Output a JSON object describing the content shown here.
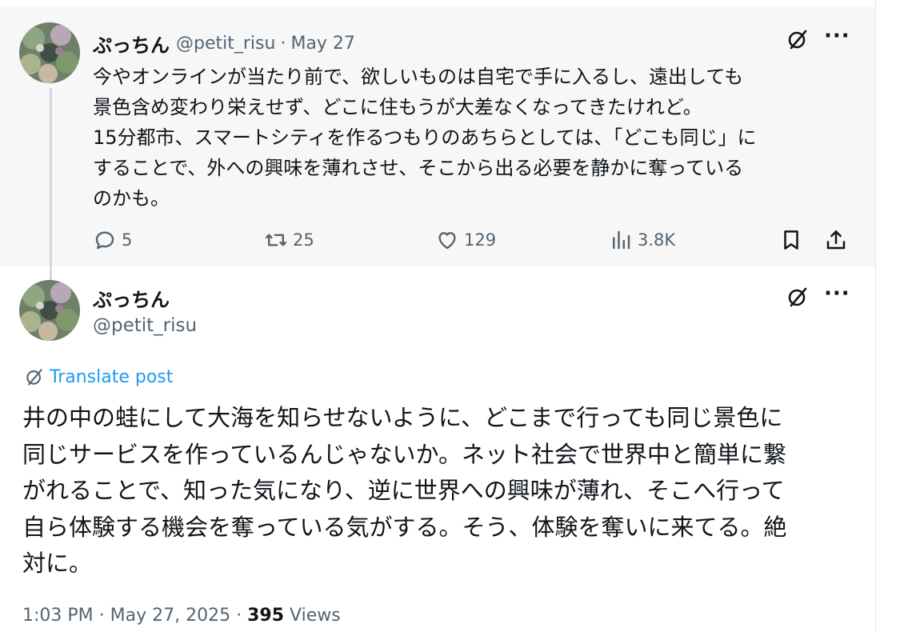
{
  "parent_tweet": {
    "display_name": "ぷっちん",
    "handle": "@petit_risu",
    "separator": "·",
    "date": "May 27",
    "text": "今やオンラインが当たり前で、欲しいものは自宅で手に入るし、遠出しても\n景色含め変わり栄えせず、どこに住もうが大差なくなってきたけれど。\n15分都市、スマートシティを作るつもりのあちらとしては、「どこも同じ」に\nすることで、外への興味を薄れさせ、そこから出る必要を静かに奪っている\nのかも。",
    "reply_count": "5",
    "repost_count": "25",
    "like_count": "129",
    "view_count": "3.8K",
    "more_label": "···"
  },
  "main_tweet": {
    "display_name": "ぷっちん",
    "handle": "@petit_risu",
    "translate_label": "Translate post",
    "text": "井の中の蛙にして大海を知らせないように、どこまで行っても同じ景色に\n同じサービスを作っているんじゃないか。ネット社会で世界中と簡単に繋\nがれることで、知った気になり、逆に世界への興味が薄れ、そこへ行って\n自ら体験する機会を奪っている気がする。そう、体験を奪いに来てる。絶\n対に。",
    "time": "1:03 PM",
    "separator": "·",
    "date": "May 27, 2025",
    "views": "395",
    "views_label": "Views",
    "more_label": "···"
  },
  "icons": [
    "avatar-succulents",
    "grok-slash-icon",
    "more-icon",
    "reply-icon",
    "repost-icon",
    "like-icon",
    "views-icon",
    "bookmark-icon",
    "share-icon",
    "translate-icon"
  ],
  "colors": {
    "link_blue": "#1d9bf0",
    "secondary_text": "#536471",
    "parent_bg": "#f7f7f7"
  }
}
